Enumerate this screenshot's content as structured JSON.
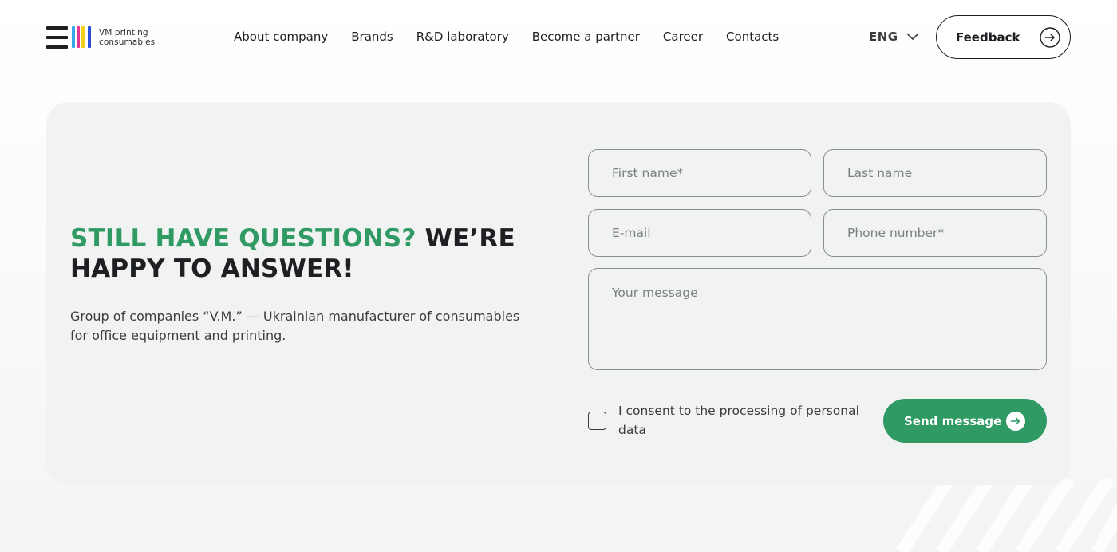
{
  "brand": {
    "name_line1": "VM printing",
    "name_line2": "consumables",
    "bar_colors": [
      "#35a6e8",
      "#e6338f",
      "#f4cf1a",
      "#2a4fd9"
    ]
  },
  "nav": {
    "items": [
      {
        "label": "About company"
      },
      {
        "label": "Brands"
      },
      {
        "label": "R&D laboratory"
      },
      {
        "label": "Become a partner"
      },
      {
        "label": "Career"
      },
      {
        "label": "Contacts"
      }
    ]
  },
  "language": {
    "current": "ENG",
    "icon": "chevron-down-icon"
  },
  "feedback": {
    "label": "Feedback",
    "icon": "arrow-right-circle-icon"
  },
  "section": {
    "heading_accent": "Still have questions?",
    "heading_rest": "We’re happy to answer!",
    "description": "Group of companies “V.M.” — Ukrainian manufacturer of consumables for office equipment and printing."
  },
  "form": {
    "first_name": {
      "placeholder": "First name*",
      "value": ""
    },
    "last_name": {
      "placeholder": "Last name",
      "value": ""
    },
    "email": {
      "placeholder": "E-mail",
      "value": ""
    },
    "phone": {
      "placeholder": "Phone number*",
      "value": ""
    },
    "message": {
      "placeholder": "Your message",
      "value": ""
    },
    "consent_label": "I consent to the processing of personal data",
    "consent_checked": false,
    "submit_label": "Send message"
  },
  "colors": {
    "accent": "#2f9a63",
    "text": "#1d1f22",
    "card_bg": "#f1f3f2"
  }
}
